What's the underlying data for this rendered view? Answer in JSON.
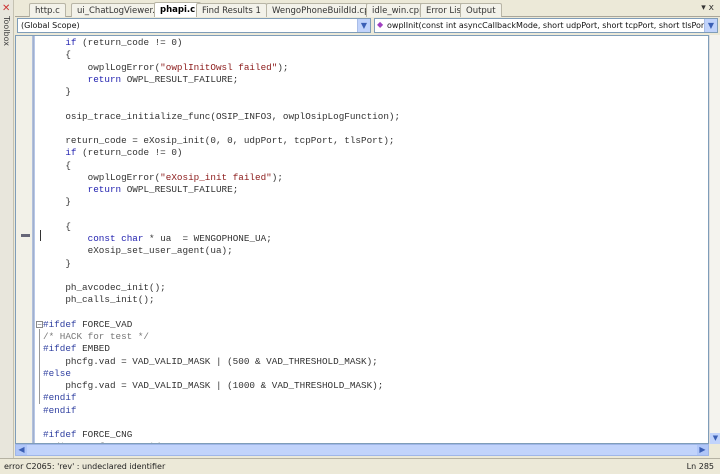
{
  "toolbox": {
    "label": "Toolbox"
  },
  "tabs": [
    {
      "label": "http.c",
      "active": false
    },
    {
      "label": "ui_ChatLogViewer.h",
      "active": false
    },
    {
      "label": "phapi.c",
      "active": true
    },
    {
      "label": "Find Results 1",
      "active": false
    },
    {
      "label": "WengoPhoneBuildId.cpp",
      "active": false
    },
    {
      "label": "idle_win.cpp",
      "active": false
    },
    {
      "label": "Error List",
      "active": false
    },
    {
      "label": "Output",
      "active": false
    }
  ],
  "tab_controls": {
    "dropdown": "▾",
    "close": "x"
  },
  "navbar": {
    "scope": "(Global Scope)",
    "member": "owplInit(const int asyncCallbackMode, short udpPort, short tcpPort, short tlsPort, const char"
  },
  "code": [
    [
      [
        "    ",
        "pl"
      ],
      [
        "if",
        "kw"
      ],
      [
        " (return_code != 0)",
        "pl"
      ]
    ],
    [
      [
        "    {",
        "pl"
      ]
    ],
    [
      [
        "        owplLogError(",
        "pl"
      ],
      [
        "\"owplInitOwsl failed\"",
        "str"
      ],
      [
        ");",
        "pl"
      ]
    ],
    [
      [
        "        ",
        "pl"
      ],
      [
        "return",
        "kw"
      ],
      [
        " OWPL_RESULT_FAILURE;",
        "pl"
      ]
    ],
    [
      [
        "    }",
        "pl"
      ]
    ],
    [],
    [
      [
        "    osip_trace_initialize_func(OSIP_INFO3, owplOsipLogFunction);",
        "pl"
      ]
    ],
    [],
    [
      [
        "    return_code = eXosip_init(0, 0, udpPort, tcpPort, tlsPort);",
        "pl"
      ]
    ],
    [
      [
        "    ",
        "pl"
      ],
      [
        "if",
        "kw"
      ],
      [
        " (return_code != 0)",
        "pl"
      ]
    ],
    [
      [
        "    {",
        "pl"
      ]
    ],
    [
      [
        "        owplLogError(",
        "pl"
      ],
      [
        "\"eXosip_init failed\"",
        "str"
      ],
      [
        ");",
        "pl"
      ]
    ],
    [
      [
        "        ",
        "pl"
      ],
      [
        "return",
        "kw"
      ],
      [
        " OWPL_RESULT_FAILURE;",
        "pl"
      ]
    ],
    [
      [
        "    }",
        "pl"
      ]
    ],
    [],
    [
      [
        "    {",
        "pl"
      ]
    ],
    [
      [
        "        ",
        "pl"
      ],
      [
        "const",
        "kw"
      ],
      [
        " ",
        "pl"
      ],
      [
        "char",
        "kw"
      ],
      [
        " * ua  = WENGOPHONE_UA;",
        "pl"
      ]
    ],
    [
      [
        "        eXosip_set_user_agent(ua);",
        "pl"
      ]
    ],
    [
      [
        "    }",
        "pl"
      ]
    ],
    [],
    [
      [
        "    ph_avcodec_init();",
        "pl"
      ]
    ],
    [
      [
        "    ph_calls_init();",
        "pl"
      ]
    ],
    [],
    [
      [
        "#ifdef",
        "pp"
      ],
      [
        " FORCE_VAD",
        "pl"
      ]
    ],
    [
      [
        "/* HACK for test */",
        "cm"
      ]
    ],
    [
      [
        "#ifdef",
        "pp"
      ],
      [
        " EMBED",
        "pl"
      ]
    ],
    [
      [
        "    phcfg.vad = VAD_VALID_MASK | (500 & VAD_THRESHOLD_MASK);",
        "pl"
      ]
    ],
    [
      [
        "#else",
        "pp"
      ]
    ],
    [
      [
        "    phcfg.vad = VAD_VALID_MASK | (1000 & VAD_THRESHOLD_MASK);",
        "pl"
      ]
    ],
    [
      [
        "#endif",
        "pp"
      ]
    ],
    [
      [
        "#endif",
        "pp"
      ]
    ],
    [],
    [
      [
        "#ifdef",
        "pp"
      ],
      [
        " FORCE_CNG",
        "pl"
      ]
    ],
    [
      [
        "  /* HACK for test */",
        "cm"
      ]
    ]
  ],
  "status": {
    "message": "error C2065: 'rev' : undeclared identifier",
    "line": "Ln 285"
  }
}
